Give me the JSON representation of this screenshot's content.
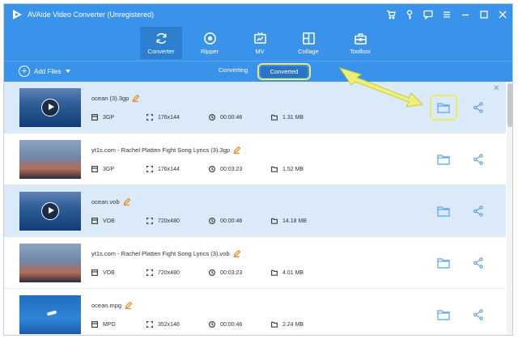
{
  "app": {
    "title": "AVAide Video Converter (Unregistered)"
  },
  "tabs": [
    {
      "label": "Converter"
    },
    {
      "label": "Ripper"
    },
    {
      "label": "MV"
    },
    {
      "label": "Collage"
    },
    {
      "label": "Toolbox"
    }
  ],
  "toolbar": {
    "add_files": "Add Files",
    "converting": "Converting",
    "converted": "Converted"
  },
  "files": [
    {
      "name": "ocean (3).3gp",
      "format": "3GP",
      "resolution": "176x144",
      "duration": "00:00:46",
      "size": "1.31 MB"
    },
    {
      "name": "yt1s.com - Rachel Platten  Fight Song Lyrics (3).3gp",
      "format": "3GP",
      "resolution": "176x144",
      "duration": "00:03:23",
      "size": "1.52 MB"
    },
    {
      "name": "ocean.vob",
      "format": "VOB",
      "resolution": "720x480",
      "duration": "00:00:46",
      "size": "14.18 MB"
    },
    {
      "name": "yt1s.com - Rachel Platten  Fight Song Lyrics (3).vob",
      "format": "VOB",
      "resolution": "720x480",
      "duration": "00:03:23",
      "size": "4.01 MB"
    },
    {
      "name": "ocean.mpg",
      "format": "MPG",
      "resolution": "352x146",
      "duration": "00:00:46",
      "size": "2.24 MB"
    }
  ],
  "colors": {
    "accent": "#3a93ea",
    "highlight": "#e6ec70",
    "selected_row": "#daeaf9"
  }
}
